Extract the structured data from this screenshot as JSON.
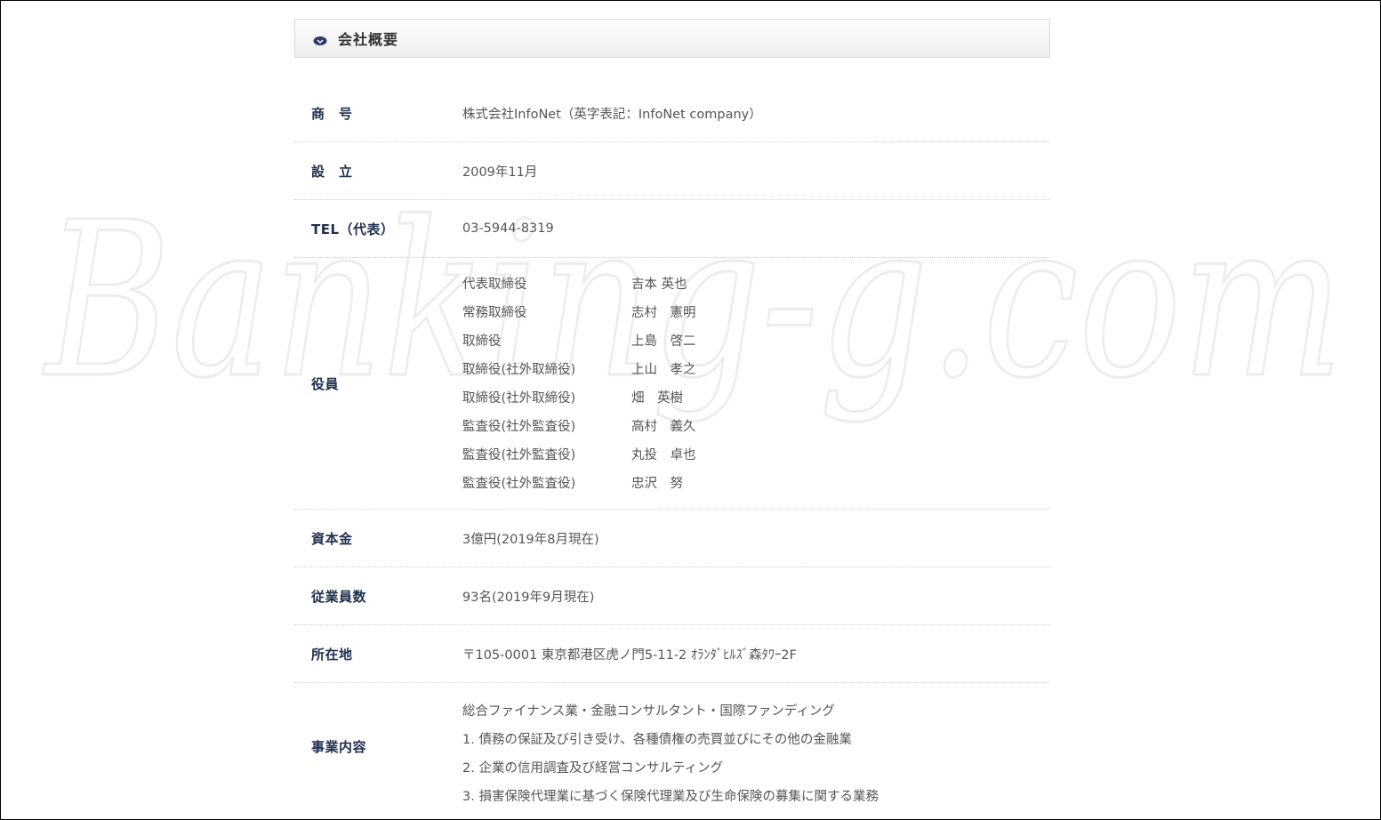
{
  "section": {
    "title": "会社概要",
    "icon": "chevron-down-badge-icon"
  },
  "watermark": {
    "text": "Banking-g.com"
  },
  "rows": [
    {
      "label": "商　号",
      "value": "株式会社InfoNet（英字表記：InfoNet company）"
    },
    {
      "label": "設　立",
      "value": "2009年11月"
    },
    {
      "label": "TEL（代表）",
      "value": "03-5944-8319"
    }
  ],
  "officers": {
    "label": "役員",
    "items": [
      {
        "title": "代表取締役",
        "name": "吉本 英也"
      },
      {
        "title": "常務取締役",
        "name": "志村　憲明"
      },
      {
        "title": "取締役",
        "name": "上島　啓二"
      },
      {
        "title": "取締役(社外取締役)",
        "name": "上山　孝之"
      },
      {
        "title": "取締役(社外取締役)",
        "name": "畑　英樹"
      },
      {
        "title": "監査役(社外監査役)",
        "name": "高村　義久"
      },
      {
        "title": "監査役(社外監査役)",
        "name": "丸投　卓也"
      },
      {
        "title": "監査役(社外監査役)",
        "name": "忠沢　努"
      }
    ]
  },
  "rows2": [
    {
      "label": "資本金",
      "value": "3億円(2019年8月現在)"
    },
    {
      "label": "従業員数",
      "value": "93名(2019年9月現在)"
    },
    {
      "label": "所在地",
      "value": "〒105-0001 東京都港区虎ノ門5-11-2 ｵﾗﾝﾀﾞﾋﾙｽﾞ森ﾀﾜｰ2F"
    }
  ],
  "business": {
    "label": "事業内容",
    "lines": [
      "総合ファイナンス業・金融コンサルタント・国際ファンディング",
      "1. 債務の保証及び引き受け、各種債権の売買並びにその他の金融業",
      "2. 企業の信用調査及び経営コンサルティング",
      "3. 損害保険代理業に基づく保険代理業及び生命保険の募集に関する業務"
    ]
  }
}
